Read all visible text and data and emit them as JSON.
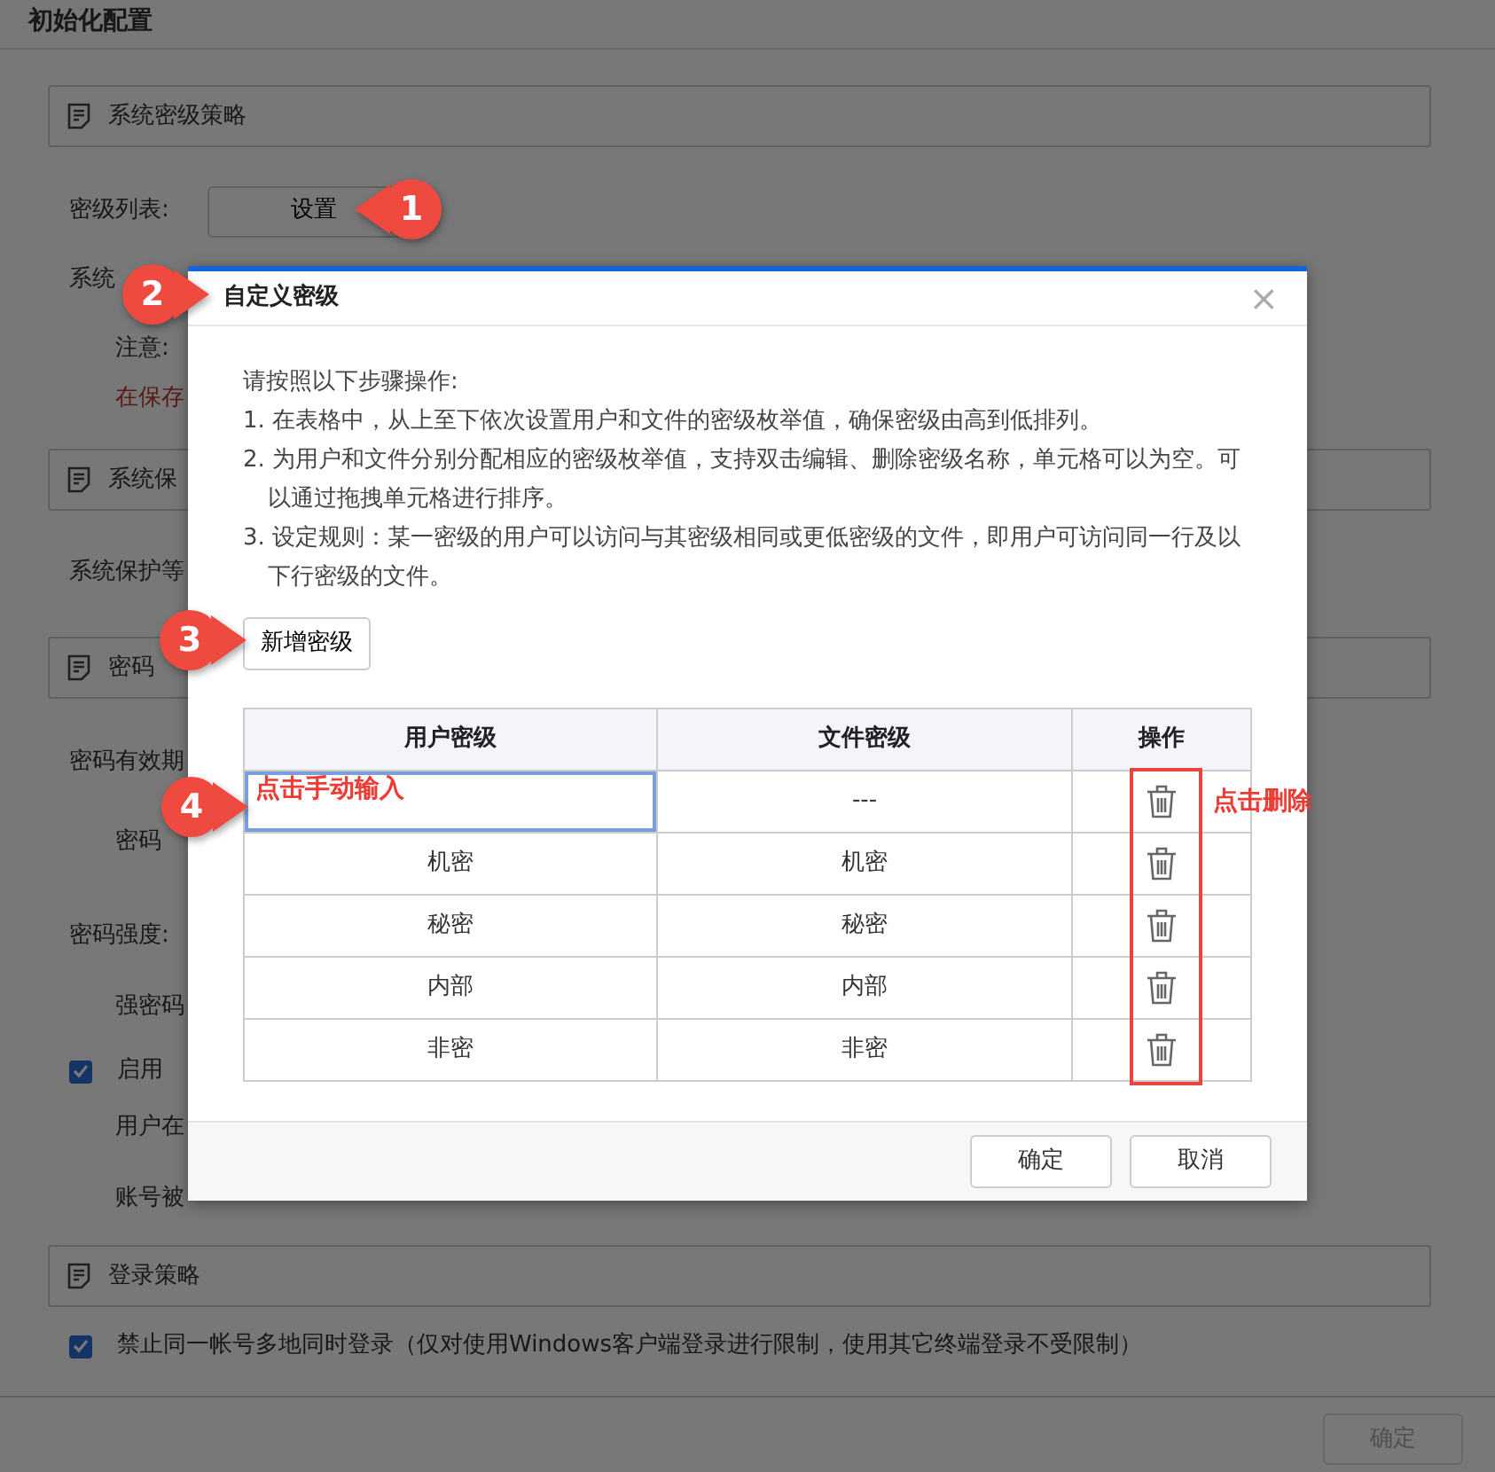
{
  "page": {
    "title": "初始化配置",
    "items": [
      {
        "kind": "section",
        "label": "系统密级策略"
      },
      {
        "kind": "button_field",
        "label": "密级列表:",
        "button": "设置"
      },
      {
        "kind": "field",
        "label": "系统"
      },
      {
        "kind": "sub",
        "label": "注意:"
      },
      {
        "kind": "warning",
        "label": "在保存"
      },
      {
        "kind": "section",
        "label": "系统保"
      },
      {
        "kind": "field",
        "label": "系统保护等"
      },
      {
        "kind": "section",
        "label": "密码"
      },
      {
        "kind": "field",
        "label": "密码有效期"
      },
      {
        "kind": "sub",
        "label": "密码"
      },
      {
        "kind": "field",
        "label": "密码强度:"
      },
      {
        "kind": "sub",
        "label": "强密码"
      },
      {
        "kind": "checkbox",
        "label": "启用",
        "checked": true
      },
      {
        "kind": "sub",
        "label": "用户在"
      },
      {
        "kind": "sub",
        "label": "账号被"
      },
      {
        "kind": "section",
        "label": "登录策略"
      },
      {
        "kind": "checkbox",
        "label": "禁止同一帐号多地同时登录（仅对使用Windows客户端登录进行限制，使用其它终端登录不受限制）",
        "checked": true
      }
    ],
    "footer_button": {
      "label": "确定",
      "disabled": true
    }
  },
  "dialog": {
    "title": "自定义密级",
    "close": "×",
    "instructions": [
      "请按照以下步骤操作:",
      "1. 在表格中，从上至下依次设置用户和文件的密级枚举值，确保密级由高到低排列。",
      "2. 为用户和文件分别分配相应的密级枚举值，支持双击编辑、删除密级名称，单元格可以为空。可以通过拖拽单元格进行排序。",
      "3. 设定规则：某一密级的用户可以访问与其密级相同或更低密级的文件，即用户可访问同一行及以下行密级的文件。"
    ],
    "add_button": "新增密级",
    "table": {
      "columns": [
        "用户密级",
        "文件密级",
        "操作"
      ],
      "rows": [
        {
          "editing": true,
          "file_level": "---"
        },
        {
          "editing": false,
          "user_level": "机密",
          "file_level": "机密"
        },
        {
          "editing": false,
          "user_level": "秘密",
          "file_level": "秘密"
        },
        {
          "editing": false,
          "user_level": "内部",
          "file_level": "内部"
        },
        {
          "editing": false,
          "user_level": "非密",
          "file_level": "非密"
        }
      ]
    },
    "buttons": [
      "确定",
      "取消"
    ]
  },
  "callouts": [
    {
      "number": "1"
    },
    {
      "number": "2"
    },
    {
      "number": "3"
    },
    {
      "number": "4"
    }
  ],
  "notes": [
    {
      "text": "点击手动输入"
    },
    {
      "text": "点击删除"
    }
  ]
}
